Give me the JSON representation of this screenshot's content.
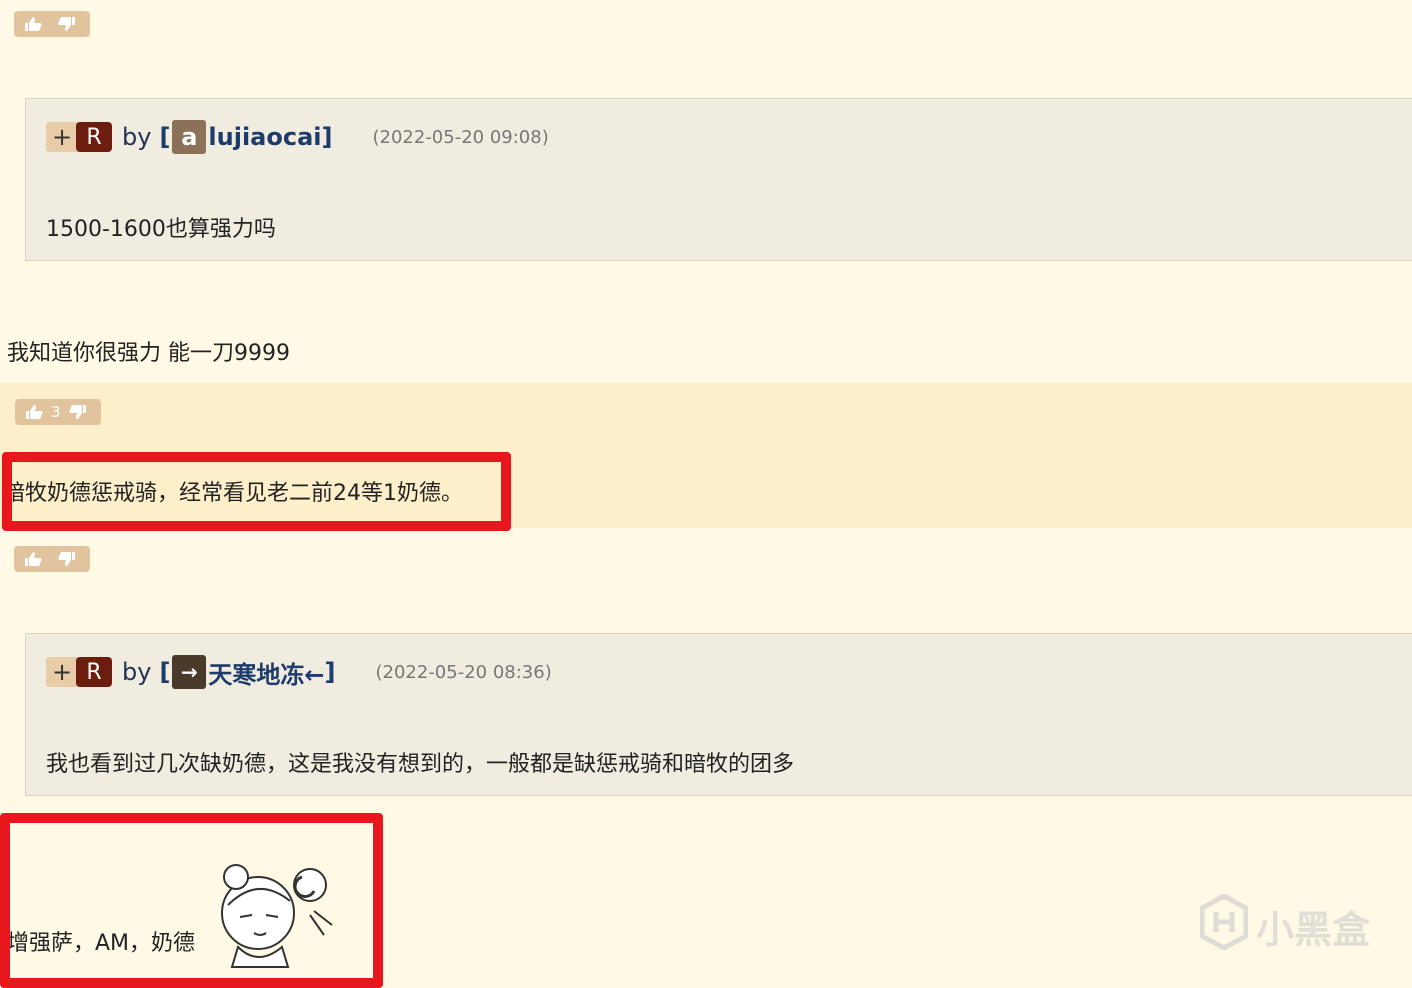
{
  "votes": {
    "top": {
      "count": ""
    },
    "highlighted": {
      "count": "3"
    },
    "middle": {
      "count": ""
    }
  },
  "quote1": {
    "plus": "+",
    "r": "R",
    "by": "by",
    "open_bracket": "[",
    "avatar_char": "a",
    "username": "lujiaocai",
    "close_bracket": "]",
    "time": "(2022-05-20 09:08)",
    "body": "1500-1600也算强力吗"
  },
  "reply1": "我知道你很强力 能一刀9999",
  "highlight_post": "暗牧奶德惩戒骑，经常看见老二前24等1奶德。",
  "quote2": {
    "plus": "+",
    "r": "R",
    "by": "by",
    "open_bracket": "[",
    "avatar_char": "→",
    "username": "天寒地冻←",
    "close_bracket": "]",
    "time": "(2022-05-20 08:36)",
    "body": "我也看到过几次缺奶德，这是我没有想到的，一般都是缺惩戒骑和暗牧的团多"
  },
  "reply2": "增强萨，AM，奶德",
  "watermark": "小黑盒",
  "colors": {
    "background": "#fff9e5",
    "highlight_band": "#fdefc9",
    "vote_button": "#e1c49d",
    "r_badge": "#6b1e0e",
    "username": "#1d3b6b",
    "red_annotation": "#e8171d"
  }
}
